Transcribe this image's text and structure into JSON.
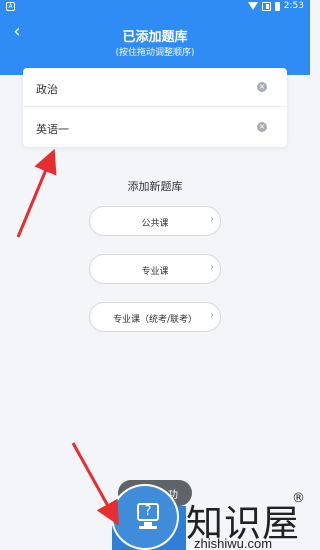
{
  "status_bar": {
    "time": "2:53",
    "app_icon": "A"
  },
  "header": {
    "back_icon": "‹",
    "title": "已添加题库",
    "subtitle": "(按住拖动调整顺序)",
    "color": "#2f8cf5"
  },
  "added_list": [
    {
      "label": "政治",
      "remove_icon": "×"
    },
    {
      "label": "英语一",
      "remove_icon": "×"
    }
  ],
  "add_section": {
    "title": "添加新题库",
    "options": [
      {
        "label": "公共课",
        "chevron": "›"
      },
      {
        "label": "专业课",
        "chevron": "›"
      },
      {
        "label": "专业课（统考/联考）",
        "chevron": "›"
      }
    ]
  },
  "bottom": {
    "button_text": "功"
  },
  "watermark": {
    "text_cn": "知识屋",
    "registered": "®",
    "text_en": "zhishiwu.com",
    "help_icon_text": "?"
  },
  "colors": {
    "annotation_arrow": "#e62e2e",
    "accent": "#2f8cf5"
  }
}
